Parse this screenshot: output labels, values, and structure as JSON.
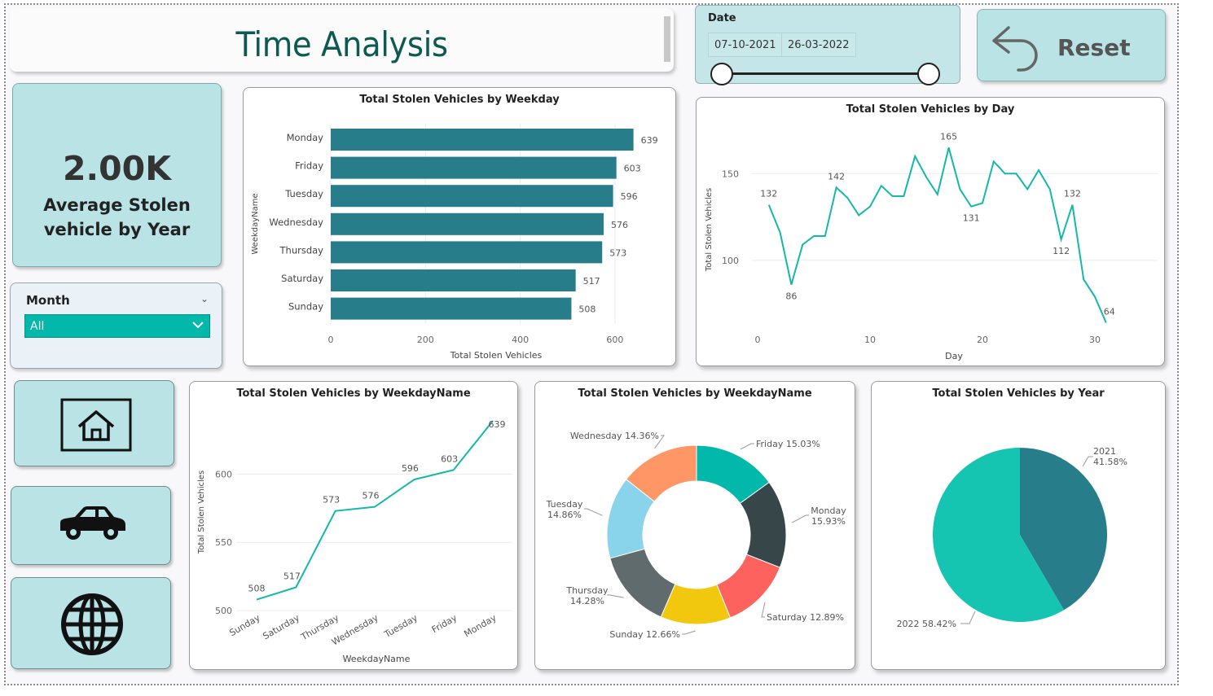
{
  "header": {
    "title": "Time Analysis"
  },
  "date_filter": {
    "label": "Date",
    "start": "07-10-2021",
    "end": "26-03-2022",
    "range_fraction": [
      0,
      1
    ]
  },
  "reset": {
    "label": "Reset",
    "icon": "undo-arrow-icon"
  },
  "kpi": {
    "value": "2.00K",
    "caption": "Average Stolen vehicle by Year"
  },
  "month_filter": {
    "label": "Month",
    "selected": "All"
  },
  "nav": [
    {
      "name": "home",
      "icon": "home-icon"
    },
    {
      "name": "vehicle",
      "icon": "car-icon"
    },
    {
      "name": "location",
      "icon": "globe-icon"
    }
  ],
  "colors": {
    "bar": "#287d8a",
    "line": "#15b8a8",
    "accent": "#01b8aa",
    "pie_2021": "#287d8a",
    "pie_2022": "#15c5b2",
    "panel": "#b9e3e4"
  },
  "chart_data": [
    {
      "id": "weekday-bar",
      "type": "bar",
      "orientation": "horizontal",
      "title": "Total Stolen Vehicles by Weekday",
      "xlabel": "Total Stolen Vehicles",
      "ylabel": "WeekdayName",
      "categories": [
        "Monday",
        "Friday",
        "Tuesday",
        "Wednesday",
        "Thursday",
        "Saturday",
        "Sunday"
      ],
      "values": [
        639,
        603,
        596,
        576,
        573,
        517,
        508
      ],
      "xlim": [
        0,
        650
      ],
      "xticks": [
        0,
        200,
        400,
        600
      ],
      "data_labels": true
    },
    {
      "id": "day-line",
      "type": "line",
      "title": "Total Stolen Vehicles by Day",
      "xlabel": "Day",
      "ylabel": "Total Stolen Vehicles",
      "x": [
        1,
        2,
        3,
        4,
        5,
        6,
        7,
        8,
        9,
        10,
        11,
        12,
        13,
        14,
        15,
        16,
        17,
        18,
        19,
        20,
        21,
        22,
        23,
        24,
        25,
        26,
        27,
        28,
        29,
        30,
        31
      ],
      "y": [
        132,
        116,
        86,
        109,
        114,
        114,
        142,
        136,
        126,
        131,
        143,
        137,
        137,
        160,
        148,
        138,
        165,
        141,
        131,
        133,
        157,
        150,
        150,
        141,
        152,
        141,
        112,
        132,
        89,
        79,
        64
      ],
      "ylim": [
        60,
        175
      ],
      "yticks": [
        100,
        150
      ],
      "xticks": [
        0,
        10,
        20,
        30
      ],
      "labeled_points": [
        {
          "x": 1,
          "label": "132"
        },
        {
          "x": 3,
          "label": "86"
        },
        {
          "x": 7,
          "label": "142"
        },
        {
          "x": 17,
          "label": "165"
        },
        {
          "x": 19,
          "label": "131"
        },
        {
          "x": 27,
          "label": "112"
        },
        {
          "x": 28,
          "label": "132"
        },
        {
          "x": 31,
          "label": "64"
        }
      ],
      "gridlines": true
    },
    {
      "id": "weekdayname-line",
      "type": "line",
      "title": "Total Stolen Vehicles by WeekdayName",
      "xlabel": "WeekdayName",
      "ylabel": "Total Stolen Vehicles",
      "categories": [
        "Sunday",
        "Saturday",
        "Thursday",
        "Wednesday",
        "Tuesday",
        "Friday",
        "Monday"
      ],
      "values": [
        508,
        517,
        573,
        576,
        596,
        603,
        639
      ],
      "ylim": [
        500,
        645
      ],
      "yticks": [
        500,
        550,
        600
      ],
      "data_labels": true
    },
    {
      "id": "weekday-donut",
      "type": "pie",
      "subtype": "donut",
      "title": "Total Stolen Vehicles by WeekdayName",
      "slices": [
        {
          "name": "Friday",
          "value": 15.03,
          "label": "Friday 15.03%",
          "color": "#01b8aa"
        },
        {
          "name": "Monday",
          "value": 15.93,
          "label": "Monday 15.93%",
          "color": "#374649"
        },
        {
          "name": "Saturday",
          "value": 12.89,
          "label": "Saturday 12.89%",
          "color": "#fd625e"
        },
        {
          "name": "Sunday",
          "value": 12.66,
          "label": "Sunday 12.66%",
          "color": "#f2c80f"
        },
        {
          "name": "Thursday",
          "value": 14.28,
          "label": "Thursday 14.28%",
          "color": "#5f6b6d"
        },
        {
          "name": "Tuesday",
          "value": 14.86,
          "label": "Tuesday 14.86%",
          "color": "#8ad4eb"
        },
        {
          "name": "Wednesday",
          "value": 14.36,
          "label": "Wednesday 14.36%",
          "color": "#fe9666"
        }
      ]
    },
    {
      "id": "year-pie",
      "type": "pie",
      "title": "Total Stolen Vehicles by Year",
      "slices": [
        {
          "name": "2021",
          "value": 41.58,
          "label_top": "2021",
          "label_bottom": "41.58%",
          "color": "#287d8a"
        },
        {
          "name": "2022",
          "value": 58.42,
          "label": "2022 58.42%",
          "color": "#15c5b2"
        }
      ]
    }
  ]
}
